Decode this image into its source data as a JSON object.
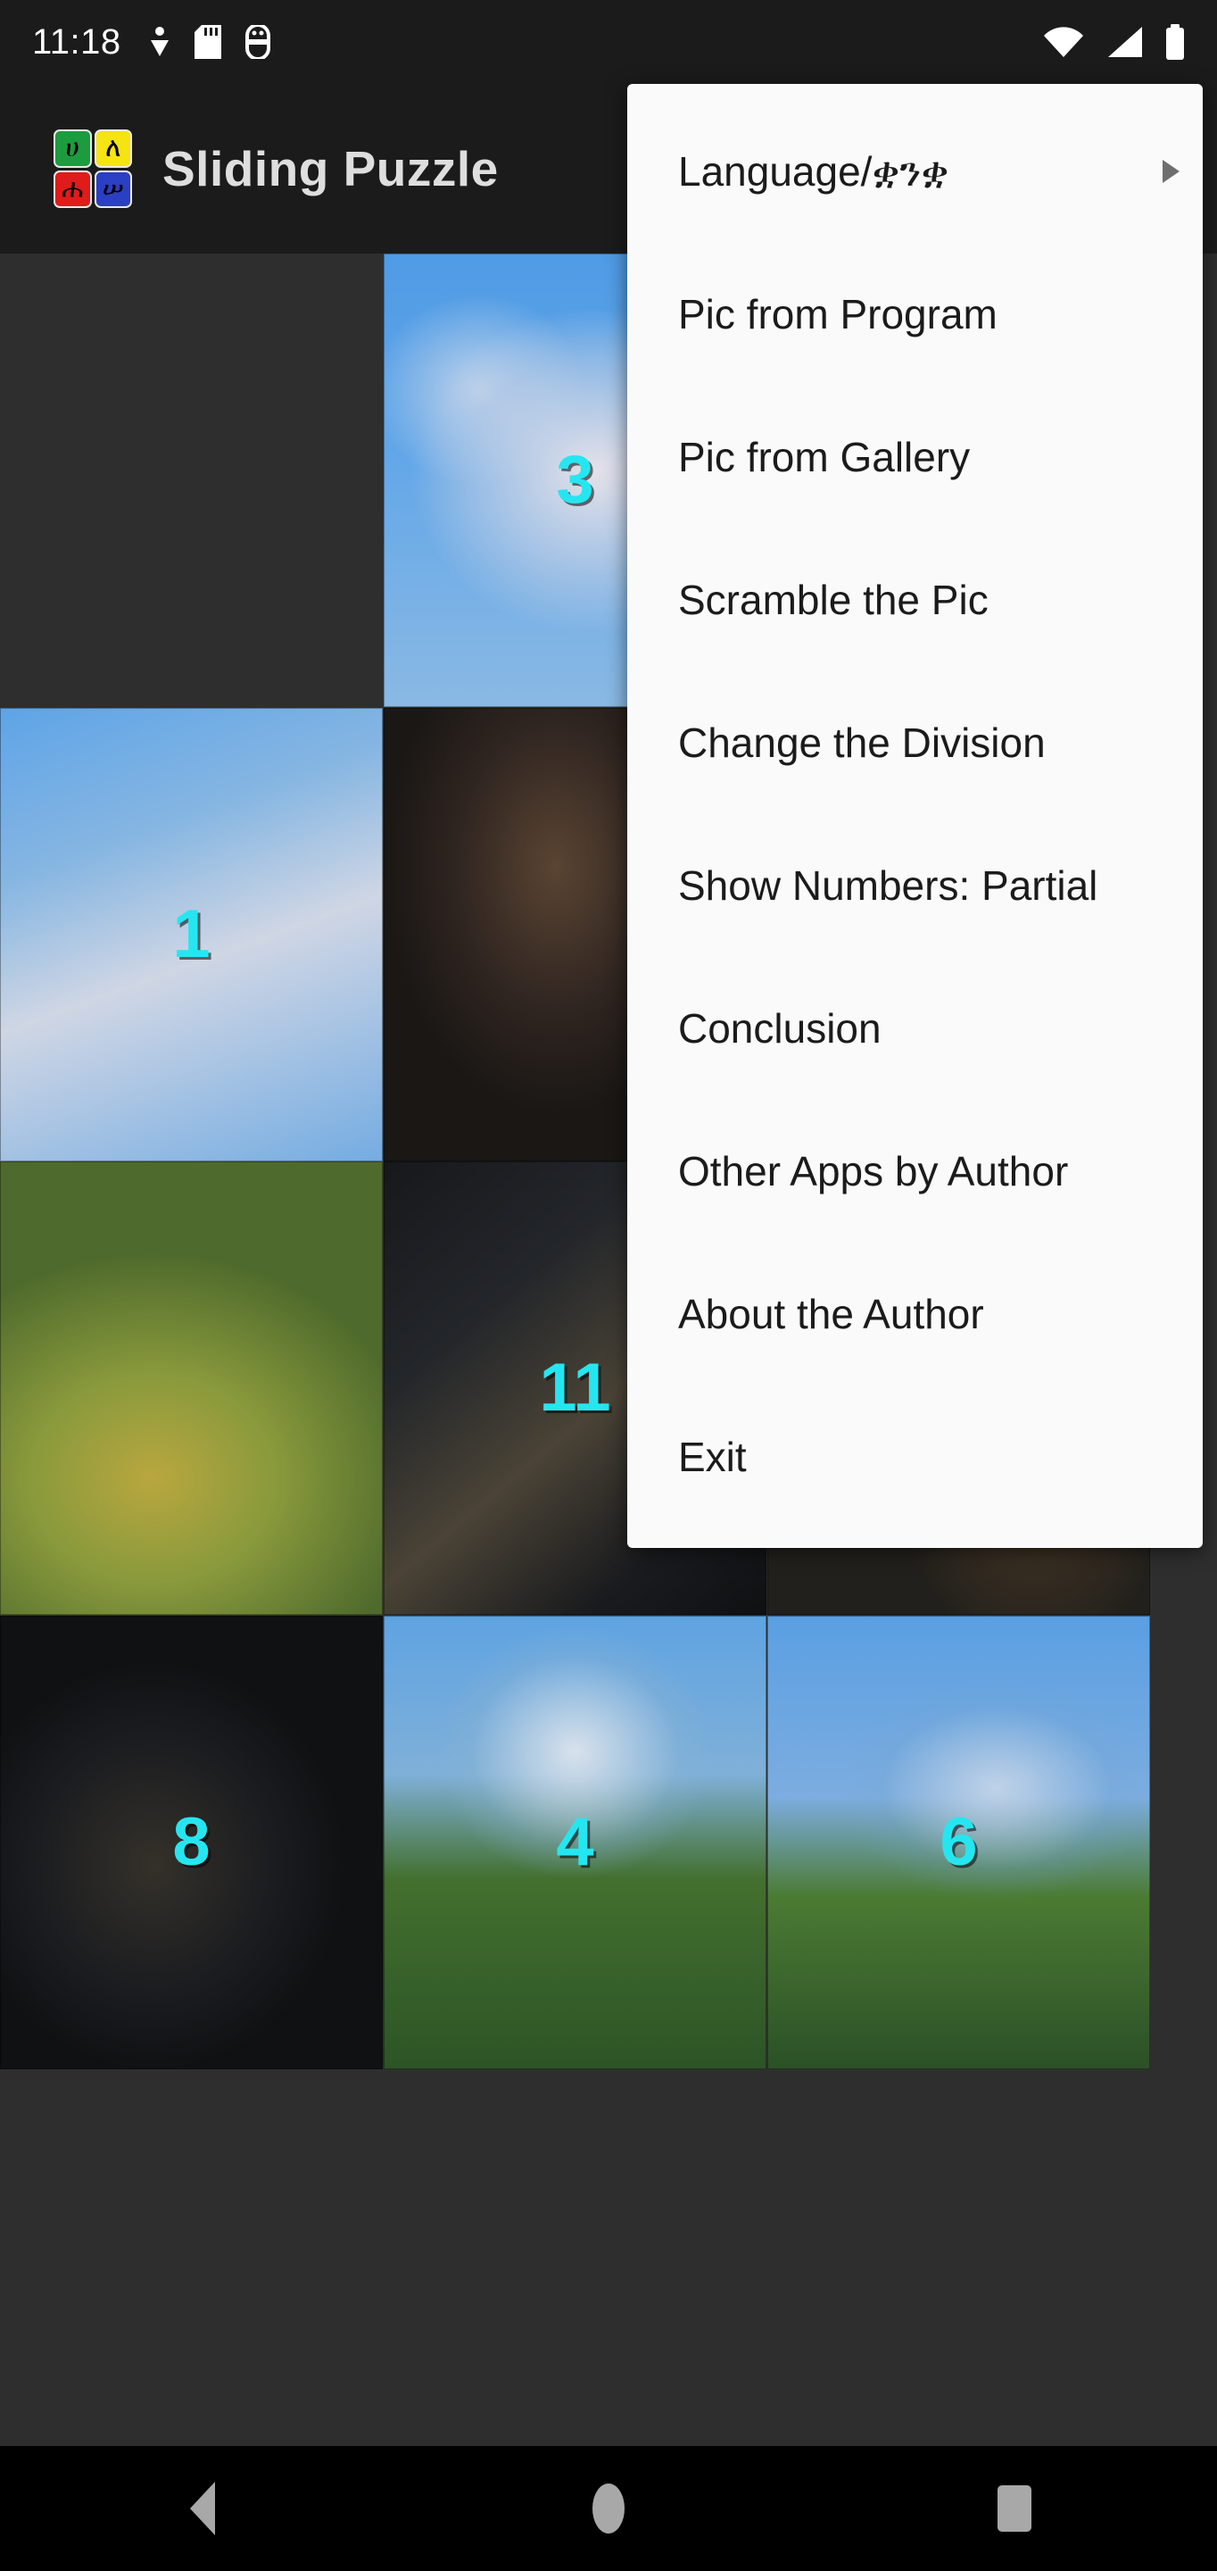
{
  "statusbar": {
    "time": "11:18",
    "left_icons": [
      "location-icon",
      "sd-card-icon",
      "android-debug-icon"
    ],
    "right_icons": [
      "wifi-icon",
      "cellular-signal-icon",
      "battery-icon"
    ]
  },
  "appbar": {
    "title": "Sliding Puzzle",
    "logo": {
      "cells": [
        {
          "char": "ሀ",
          "color": "#1d9b3f"
        },
        {
          "char": "ለ",
          "color": "#f5e312"
        },
        {
          "char": "ሐ",
          "color": "#e01b1b"
        },
        {
          "char": "ሠ",
          "color": "#2b3fc4"
        }
      ]
    }
  },
  "board": {
    "columns": 3,
    "rows": 4,
    "number_color": "#25e6f0",
    "tiles": [
      {
        "row": 0,
        "col": 0,
        "number": "",
        "empty": true,
        "art": ""
      },
      {
        "row": 0,
        "col": 1,
        "number": "3",
        "empty": false,
        "art": "cloud"
      },
      {
        "row": 0,
        "col": 2,
        "number": "",
        "empty": false,
        "art": "sky"
      },
      {
        "row": 1,
        "col": 0,
        "number": "1",
        "empty": false,
        "art": "sky2"
      },
      {
        "row": 1,
        "col": 1,
        "number": "",
        "empty": false,
        "art": "figface"
      },
      {
        "row": 1,
        "col": 2,
        "number": "",
        "empty": false,
        "art": "skydark"
      },
      {
        "row": 2,
        "col": 0,
        "number": "",
        "empty": false,
        "art": "grass"
      },
      {
        "row": 2,
        "col": 1,
        "number": "11",
        "empty": false,
        "art": "chain"
      },
      {
        "row": 2,
        "col": 2,
        "number": "",
        "empty": false,
        "art": "horse"
      },
      {
        "row": 3,
        "col": 0,
        "number": "8",
        "empty": false,
        "art": "chain2"
      },
      {
        "row": 3,
        "col": 1,
        "number": "4",
        "empty": false,
        "art": "bush"
      },
      {
        "row": 3,
        "col": 2,
        "number": "6",
        "empty": false,
        "art": "bush2"
      }
    ]
  },
  "menu": {
    "items": [
      {
        "label": "Language/ቋንቋ",
        "has_submenu": true
      },
      {
        "label": "Pic from Program",
        "has_submenu": false
      },
      {
        "label": "Pic from Gallery",
        "has_submenu": false
      },
      {
        "label": "Scramble the Pic",
        "has_submenu": false
      },
      {
        "label": "Change the Division",
        "has_submenu": false
      },
      {
        "label": "Show Numbers: Partial",
        "has_submenu": false
      },
      {
        "label": "Conclusion",
        "has_submenu": false
      },
      {
        "label": "Other Apps by Author",
        "has_submenu": false
      },
      {
        "label": "About the Author",
        "has_submenu": false
      },
      {
        "label": "Exit",
        "has_submenu": false
      }
    ]
  },
  "navbar": {
    "buttons": [
      {
        "name": "back-button"
      },
      {
        "name": "home-button"
      },
      {
        "name": "recents-button"
      }
    ]
  }
}
